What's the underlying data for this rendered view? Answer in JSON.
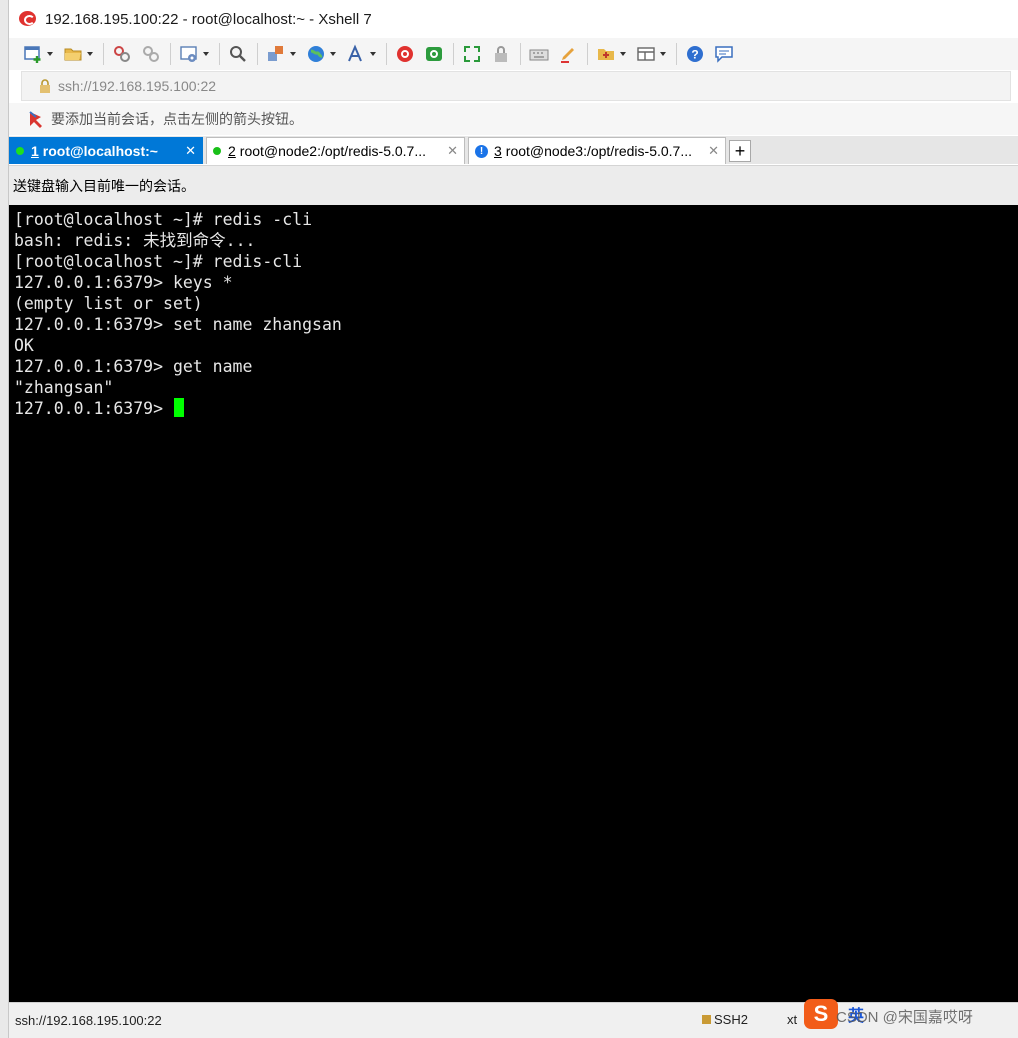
{
  "window": {
    "title": "192.168.195.100:22 - root@localhost:~ - Xshell 7"
  },
  "toolbar": {
    "icons": [
      "new-session-icon",
      "open-folder-icon",
      "disconnect-icon",
      "reconnect-icon",
      "properties-icon",
      "find-icon",
      "transfer-icon",
      "globe-icon",
      "font-icon",
      "xshell-icon",
      "xftp-icon",
      "fullscreen-icon",
      "lock-icon",
      "keyboard-icon",
      "highlight-icon",
      "add-tab-icon",
      "layout-icon",
      "help-icon",
      "chat-icon"
    ]
  },
  "address": {
    "value": "ssh://192.168.195.100:22"
  },
  "hint": {
    "text": "要添加当前会话，点击左侧的箭头按钮。"
  },
  "tabs": [
    {
      "num": "1",
      "label": "root@localhost:~",
      "status": "connected",
      "active": true
    },
    {
      "num": "2",
      "label": "root@node2:/opt/redis-5.0.7...",
      "status": "connected",
      "active": false
    },
    {
      "num": "3",
      "label": "root@node3:/opt/redis-5.0.7...",
      "status": "info",
      "active": false
    }
  ],
  "send_bar": {
    "text": "送键盘输入目前唯一的会话。"
  },
  "terminal": {
    "lines": [
      "[root@localhost ~]# redis -cli",
      "bash: redis: 未找到命令...",
      "[root@localhost ~]# redis-cli",
      "127.0.0.1:6379> keys *",
      "(empty list or set)",
      "127.0.0.1:6379> set name zhangsan",
      "OK",
      "127.0.0.1:6379> get name",
      "\"zhangsan\"",
      "127.0.0.1:6379> "
    ]
  },
  "status": {
    "address": "ssh://192.168.195.100:22",
    "protocol": "SSH2",
    "term": "xt"
  },
  "ime": {
    "logo": "S",
    "lang": "英",
    "watermark": "CSDN @宋国嘉哎呀"
  },
  "colors": {
    "accent": "#0078d7",
    "connected": "#19c019",
    "cursor": "#00ff00",
    "terminal_bg": "#000000"
  }
}
